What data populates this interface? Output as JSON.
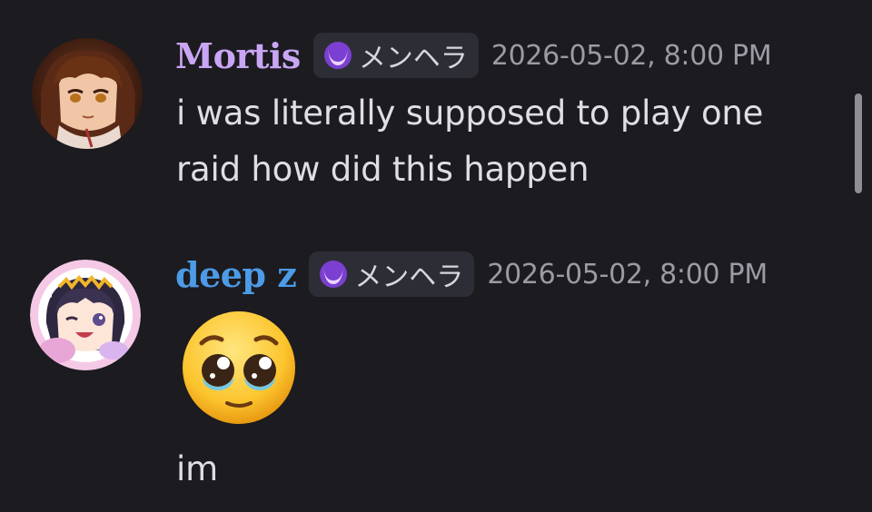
{
  "messages": [
    {
      "username": "Mortis",
      "username_color": "#c9a6f3",
      "role": "メンヘラ",
      "timestamp": "2026-05-02, 8:00 PM",
      "text_lines": [
        "i was literally supposed to play one",
        "raid how did this happen"
      ]
    },
    {
      "username": "deep z",
      "username_color": "#4d9be6",
      "role": "メンヘラ",
      "timestamp": "2026-05-02, 8:00 PM",
      "emoji": "pleading-face",
      "text_lines": [
        "im"
      ]
    }
  ],
  "colors": {
    "background": "#1b1b20",
    "role_tag_bg": "#2d2e35",
    "timestamp": "#9a9ba3"
  }
}
